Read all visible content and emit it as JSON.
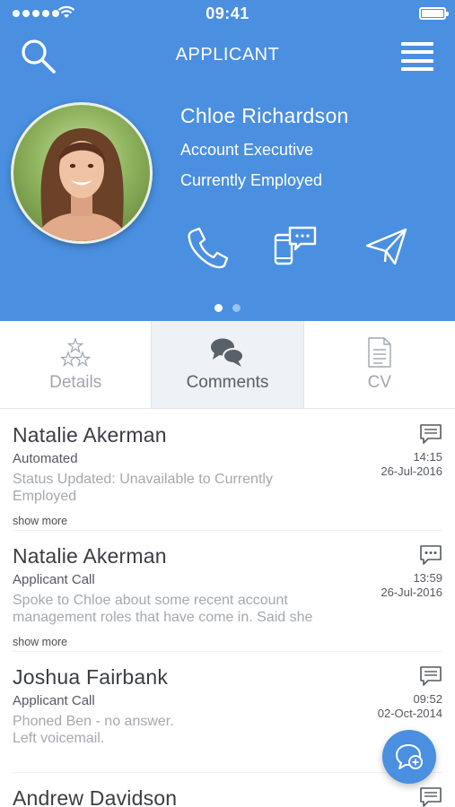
{
  "status_bar": {
    "time": "09:41"
  },
  "nav": {
    "title": "APPLICANT"
  },
  "profile": {
    "name": "Chloe Richardson",
    "job_title": "Account Executive",
    "employment_status": "Currently Employed"
  },
  "pager": {
    "count": 2,
    "active": 1
  },
  "tabs": [
    {
      "label": "Details",
      "icon": "stars-icon",
      "active": false
    },
    {
      "label": "Comments",
      "icon": "comments-icon",
      "active": true
    },
    {
      "label": "CV",
      "icon": "document-icon",
      "active": false
    }
  ],
  "comments": [
    {
      "author": "Natalie Akerman",
      "type": "Automated",
      "text": "Status Updated: Unavailable to Currently Employed",
      "time": "14:15",
      "date": "26-Jul-2016",
      "more": "show more",
      "icon": "note-icon"
    },
    {
      "author": "Natalie Akerman",
      "type": "Applicant Call",
      "text": "Spoke to Chloe about some recent account management roles that have come in. Said she",
      "time": "13:59",
      "date": "26-Jul-2016",
      "more": "show more",
      "icon": "chat-bubble-icon"
    },
    {
      "author": "Joshua Fairbank",
      "type": "Applicant Call",
      "text": "Phoned Ben - no answer.\nLeft voicemail.",
      "time": "09:52",
      "date": "02-Oct-2014",
      "icon": "note-icon"
    },
    {
      "author": "Andrew Davidson",
      "icon": "note-icon"
    }
  ],
  "colors": {
    "accent": "#4a8fe0",
    "tab_active_bg": "#eef1f5",
    "muted_text": "#a3a8ae"
  }
}
